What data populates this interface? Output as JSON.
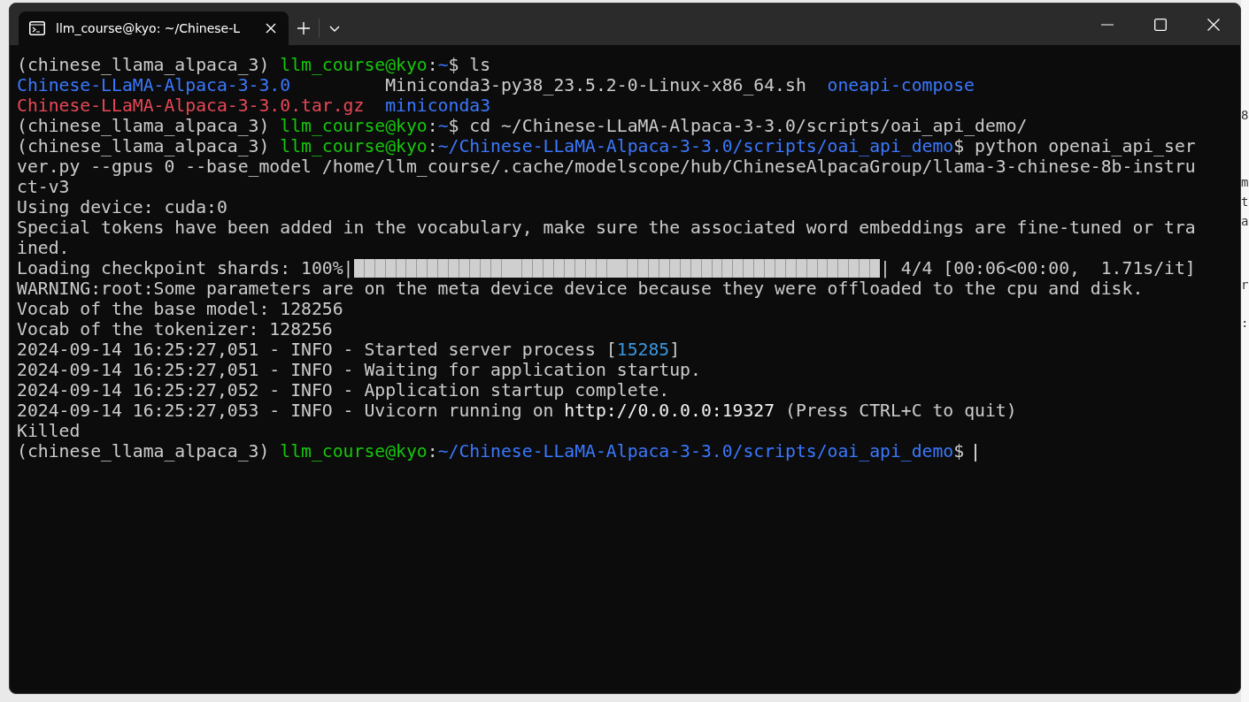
{
  "tabs": [
    {
      "title": "llm_course@kyo: ~/Chinese-L",
      "selected": true
    }
  ],
  "terminal": {
    "lines": [
      {
        "kind": "prompt",
        "cursor": false,
        "segments": [
          {
            "text": "(chinese_llama_alpaca_3) ",
            "kind": "plain"
          },
          {
            "text": "llm_course@kyo",
            "kind": "user"
          },
          {
            "text": ":",
            "kind": "plain"
          },
          {
            "text": "~",
            "kind": "path"
          },
          {
            "text": "$ ls",
            "kind": "plain"
          }
        ]
      },
      {
        "kind": "ls",
        "entries": [
          {
            "text": "Chinese-LLaMA-Alpaca-3-3.0",
            "kind": "dir"
          },
          {
            "text": "Miniconda3-py38_23.5.2-0-Linux-x86_64.sh",
            "kind": "file"
          },
          {
            "text": "oneapi-compose",
            "kind": "dir"
          }
        ]
      },
      {
        "kind": "ls",
        "entries": [
          {
            "text": "Chinese-LLaMA-Alpaca-3-3.0.tar.gz",
            "kind": "archive"
          },
          {
            "text": "miniconda3",
            "kind": "dir"
          }
        ]
      },
      {
        "kind": "prompt",
        "cursor": false,
        "segments": [
          {
            "text": "(chinese_llama_alpaca_3) ",
            "kind": "plain"
          },
          {
            "text": "llm_course@kyo",
            "kind": "user"
          },
          {
            "text": ":",
            "kind": "plain"
          },
          {
            "text": "~",
            "kind": "path"
          },
          {
            "text": "$ cd ~/Chinese-LLaMA-Alpaca-3-3.0/scripts/oai_api_demo/",
            "kind": "plain"
          }
        ]
      },
      {
        "kind": "prompt",
        "cursor": false,
        "segments": [
          {
            "text": "(chinese_llama_alpaca_3) ",
            "kind": "plain"
          },
          {
            "text": "llm_course@kyo",
            "kind": "user"
          },
          {
            "text": ":",
            "kind": "plain"
          },
          {
            "text": "~/Chinese-LLaMA-Alpaca-3-3.0/scripts/oai_api_demo",
            "kind": "path"
          },
          {
            "text": "$ python openai_api_ser",
            "kind": "plain"
          }
        ]
      },
      {
        "kind": "output",
        "segments": [
          {
            "text": "ver.py --gpus 0 --base_model /home/llm_course/.cache/modelscope/hub/ChineseAlpacaGroup/llama-3-chinese-8b-instru",
            "kind": "plain"
          }
        ]
      },
      {
        "kind": "output",
        "segments": [
          {
            "text": "ct-v3",
            "kind": "plain"
          }
        ]
      },
      {
        "kind": "output",
        "segments": [
          {
            "text": "Using device: cuda:0",
            "kind": "plain"
          }
        ]
      },
      {
        "kind": "output",
        "segments": [
          {
            "text": "Special tokens have been added in the vocabulary, make sure the associated word embeddings are fine-tuned or tra",
            "kind": "plain"
          }
        ]
      },
      {
        "kind": "output",
        "segments": [
          {
            "text": "ined.",
            "kind": "plain"
          }
        ]
      },
      {
        "kind": "progress",
        "label": "Loading checkpoint shards: 100%|",
        "level": 1,
        "after": "| 4/4 [00:06<00:00,  1.71s/it]"
      },
      {
        "kind": "output",
        "segments": [
          {
            "text": "WARNING:root:Some parameters are on the meta device device because they were offloaded to the cpu and disk.",
            "kind": "plain"
          }
        ]
      },
      {
        "kind": "output",
        "segments": [
          {
            "text": "Vocab of the base model: 128256",
            "kind": "plain"
          }
        ]
      },
      {
        "kind": "output",
        "segments": [
          {
            "text": "Vocab of the tokenizer: 128256",
            "kind": "plain"
          }
        ]
      },
      {
        "kind": "output",
        "segments": [
          {
            "text": "2024-09-14 16:25:27,051 - INFO - Started server process [",
            "kind": "plain"
          },
          {
            "text": "15285",
            "kind": "pid"
          },
          {
            "text": "]",
            "kind": "plain"
          }
        ]
      },
      {
        "kind": "output",
        "segments": [
          {
            "text": "2024-09-14 16:25:27,051 - INFO - Waiting for application startup.",
            "kind": "plain"
          }
        ]
      },
      {
        "kind": "output",
        "segments": [
          {
            "text": "2024-09-14 16:25:27,052 - INFO - Application startup complete.",
            "kind": "plain"
          }
        ]
      },
      {
        "kind": "output",
        "segments": [
          {
            "text": "2024-09-14 16:25:27,053 - INFO - Uvicorn running on ",
            "kind": "plain"
          },
          {
            "text": "http://0.0.0.0:19327",
            "kind": "bright"
          },
          {
            "text": " (Press CTRL+C to quit)",
            "kind": "plain"
          }
        ]
      },
      {
        "kind": "output",
        "segments": [
          {
            "text": "Killed",
            "kind": "plain"
          }
        ]
      },
      {
        "kind": "prompt",
        "cursor": true,
        "segments": [
          {
            "text": "(chinese_llama_alpaca_3) ",
            "kind": "plain"
          },
          {
            "text": "llm_course@kyo",
            "kind": "user"
          },
          {
            "text": ":",
            "kind": "plain"
          },
          {
            "text": "~/Chinese-LLaMA-Alpaca-3-3.0/scripts/oai_api_demo",
            "kind": "path"
          },
          {
            "text": "$ ",
            "kind": "plain"
          }
        ]
      }
    ]
  },
  "background_window": {
    "fragments": [
      "8",
      "m",
      "t",
      "a",
      "r",
      ":"
    ]
  }
}
